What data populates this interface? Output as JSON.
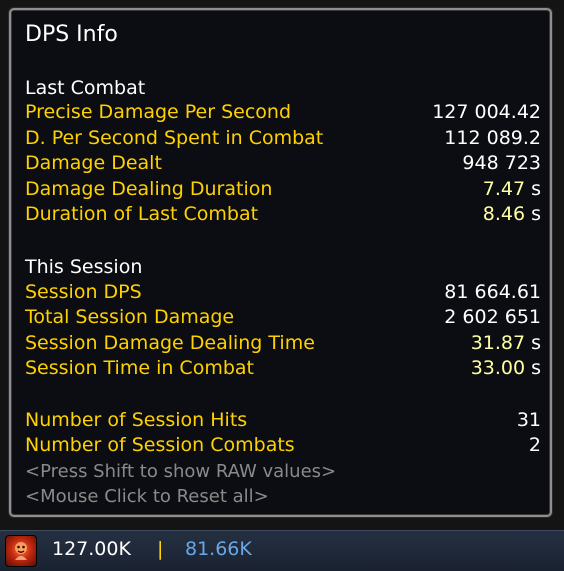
{
  "tooltip": {
    "title": "DPS Info",
    "last_combat": {
      "heading": "Last Combat",
      "rows": [
        {
          "label": "Precise Damage Per Second",
          "value": "127 004.42",
          "unit": ""
        },
        {
          "label": "D. Per Second Spent in Combat",
          "value": "112 089.2",
          "unit": ""
        },
        {
          "label": "Damage Dealt",
          "value": "948 723",
          "unit": ""
        },
        {
          "label": "Damage Dealing Duration",
          "value": "7.47",
          "unit": "s"
        },
        {
          "label": "Duration of Last Combat",
          "value": "8.46",
          "unit": "s"
        }
      ]
    },
    "session": {
      "heading": "This Session",
      "rows": [
        {
          "label": "Session DPS",
          "value": "81 664.61",
          "unit": ""
        },
        {
          "label": "Total Session Damage",
          "value": "2 602 651",
          "unit": ""
        },
        {
          "label": "Session Damage Dealing Time",
          "value": "31.87",
          "unit": "s"
        },
        {
          "label": "Session Time in Combat",
          "value": "33.00",
          "unit": "s"
        }
      ]
    },
    "counts": {
      "rows": [
        {
          "label": "Number of Session Hits",
          "value": "31"
        },
        {
          "label": "Number of Session Combats",
          "value": "2"
        }
      ]
    },
    "hints": {
      "shift": "<Press Shift to show RAW values>",
      "click": "<Mouse Click to Reset all>"
    }
  },
  "bar": {
    "icon": "dps-meter-icon",
    "current_dps": "127.00K",
    "separator": "|",
    "session_dps": "81.66K",
    "colors": {
      "current": "#ffffff",
      "separator": "#ffd100",
      "session": "#69a8e8"
    }
  },
  "colors": {
    "label": "#ffd100",
    "value": "#ffffff",
    "seconds_value": "#ffffa0",
    "hint": "#8a8a8a",
    "border": "#8f8f8f",
    "background": "#0b0d12"
  }
}
